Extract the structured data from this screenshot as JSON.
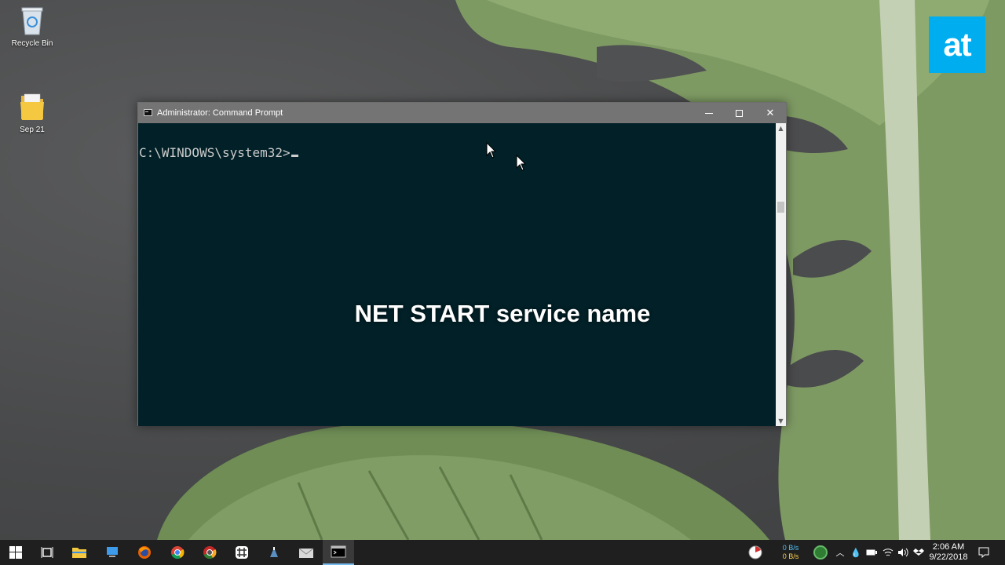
{
  "desktop": {
    "icons": [
      {
        "label": "Recycle Bin"
      },
      {
        "label": "Sep 21"
      }
    ],
    "brand_logo": "at"
  },
  "window": {
    "title": "Administrator: Command Prompt",
    "prompt": "C:\\WINDOWS\\system32>"
  },
  "caption": "NET START service name",
  "taskbar": {
    "apps": [
      {
        "name": "start-icon"
      },
      {
        "name": "task-view-icon"
      },
      {
        "name": "file-explorer-icon"
      },
      {
        "name": "pc-icon"
      },
      {
        "name": "firefox-icon"
      },
      {
        "name": "chrome-icon"
      },
      {
        "name": "chrome-canary-icon"
      },
      {
        "name": "slack-icon"
      },
      {
        "name": "app-icon"
      },
      {
        "name": "mail-icon"
      },
      {
        "name": "command-prompt-icon"
      }
    ],
    "tray": {
      "net_up": "0 B/s",
      "net_down": "0 B/s",
      "time": "2:06 AM",
      "date": "9/22/2018"
    }
  },
  "colors": {
    "console_bg": "#012027",
    "titlebar_bg": "#747474",
    "brand": "#00aeef",
    "taskbar_bg": "#1f1f1f"
  }
}
